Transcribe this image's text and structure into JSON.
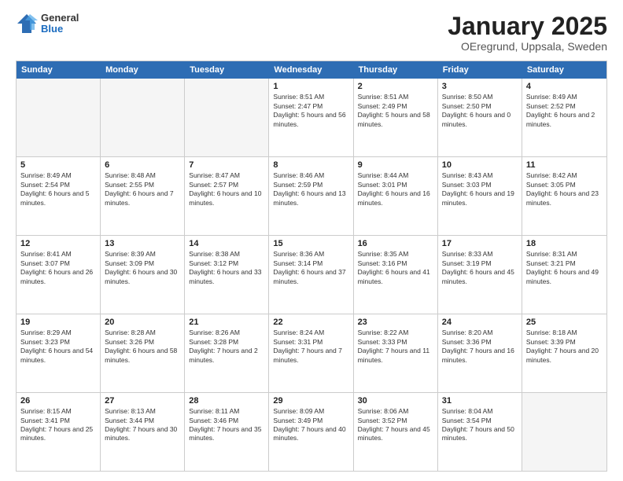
{
  "logo": {
    "general": "General",
    "blue": "Blue"
  },
  "title": "January 2025",
  "location": "OEregrund, Uppsala, Sweden",
  "header_days": [
    "Sunday",
    "Monday",
    "Tuesday",
    "Wednesday",
    "Thursday",
    "Friday",
    "Saturday"
  ],
  "weeks": [
    [
      {
        "day": "",
        "sunrise": "",
        "sunset": "",
        "daylight": ""
      },
      {
        "day": "",
        "sunrise": "",
        "sunset": "",
        "daylight": ""
      },
      {
        "day": "",
        "sunrise": "",
        "sunset": "",
        "daylight": ""
      },
      {
        "day": "1",
        "sunrise": "Sunrise: 8:51 AM",
        "sunset": "Sunset: 2:47 PM",
        "daylight": "Daylight: 5 hours and 56 minutes."
      },
      {
        "day": "2",
        "sunrise": "Sunrise: 8:51 AM",
        "sunset": "Sunset: 2:49 PM",
        "daylight": "Daylight: 5 hours and 58 minutes."
      },
      {
        "day": "3",
        "sunrise": "Sunrise: 8:50 AM",
        "sunset": "Sunset: 2:50 PM",
        "daylight": "Daylight: 6 hours and 0 minutes."
      },
      {
        "day": "4",
        "sunrise": "Sunrise: 8:49 AM",
        "sunset": "Sunset: 2:52 PM",
        "daylight": "Daylight: 6 hours and 2 minutes."
      }
    ],
    [
      {
        "day": "5",
        "sunrise": "Sunrise: 8:49 AM",
        "sunset": "Sunset: 2:54 PM",
        "daylight": "Daylight: 6 hours and 5 minutes."
      },
      {
        "day": "6",
        "sunrise": "Sunrise: 8:48 AM",
        "sunset": "Sunset: 2:55 PM",
        "daylight": "Daylight: 6 hours and 7 minutes."
      },
      {
        "day": "7",
        "sunrise": "Sunrise: 8:47 AM",
        "sunset": "Sunset: 2:57 PM",
        "daylight": "Daylight: 6 hours and 10 minutes."
      },
      {
        "day": "8",
        "sunrise": "Sunrise: 8:46 AM",
        "sunset": "Sunset: 2:59 PM",
        "daylight": "Daylight: 6 hours and 13 minutes."
      },
      {
        "day": "9",
        "sunrise": "Sunrise: 8:44 AM",
        "sunset": "Sunset: 3:01 PM",
        "daylight": "Daylight: 6 hours and 16 minutes."
      },
      {
        "day": "10",
        "sunrise": "Sunrise: 8:43 AM",
        "sunset": "Sunset: 3:03 PM",
        "daylight": "Daylight: 6 hours and 19 minutes."
      },
      {
        "day": "11",
        "sunrise": "Sunrise: 8:42 AM",
        "sunset": "Sunset: 3:05 PM",
        "daylight": "Daylight: 6 hours and 23 minutes."
      }
    ],
    [
      {
        "day": "12",
        "sunrise": "Sunrise: 8:41 AM",
        "sunset": "Sunset: 3:07 PM",
        "daylight": "Daylight: 6 hours and 26 minutes."
      },
      {
        "day": "13",
        "sunrise": "Sunrise: 8:39 AM",
        "sunset": "Sunset: 3:09 PM",
        "daylight": "Daylight: 6 hours and 30 minutes."
      },
      {
        "day": "14",
        "sunrise": "Sunrise: 8:38 AM",
        "sunset": "Sunset: 3:12 PM",
        "daylight": "Daylight: 6 hours and 33 minutes."
      },
      {
        "day": "15",
        "sunrise": "Sunrise: 8:36 AM",
        "sunset": "Sunset: 3:14 PM",
        "daylight": "Daylight: 6 hours and 37 minutes."
      },
      {
        "day": "16",
        "sunrise": "Sunrise: 8:35 AM",
        "sunset": "Sunset: 3:16 PM",
        "daylight": "Daylight: 6 hours and 41 minutes."
      },
      {
        "day": "17",
        "sunrise": "Sunrise: 8:33 AM",
        "sunset": "Sunset: 3:19 PM",
        "daylight": "Daylight: 6 hours and 45 minutes."
      },
      {
        "day": "18",
        "sunrise": "Sunrise: 8:31 AM",
        "sunset": "Sunset: 3:21 PM",
        "daylight": "Daylight: 6 hours and 49 minutes."
      }
    ],
    [
      {
        "day": "19",
        "sunrise": "Sunrise: 8:29 AM",
        "sunset": "Sunset: 3:23 PM",
        "daylight": "Daylight: 6 hours and 54 minutes."
      },
      {
        "day": "20",
        "sunrise": "Sunrise: 8:28 AM",
        "sunset": "Sunset: 3:26 PM",
        "daylight": "Daylight: 6 hours and 58 minutes."
      },
      {
        "day": "21",
        "sunrise": "Sunrise: 8:26 AM",
        "sunset": "Sunset: 3:28 PM",
        "daylight": "Daylight: 7 hours and 2 minutes."
      },
      {
        "day": "22",
        "sunrise": "Sunrise: 8:24 AM",
        "sunset": "Sunset: 3:31 PM",
        "daylight": "Daylight: 7 hours and 7 minutes."
      },
      {
        "day": "23",
        "sunrise": "Sunrise: 8:22 AM",
        "sunset": "Sunset: 3:33 PM",
        "daylight": "Daylight: 7 hours and 11 minutes."
      },
      {
        "day": "24",
        "sunrise": "Sunrise: 8:20 AM",
        "sunset": "Sunset: 3:36 PM",
        "daylight": "Daylight: 7 hours and 16 minutes."
      },
      {
        "day": "25",
        "sunrise": "Sunrise: 8:18 AM",
        "sunset": "Sunset: 3:39 PM",
        "daylight": "Daylight: 7 hours and 20 minutes."
      }
    ],
    [
      {
        "day": "26",
        "sunrise": "Sunrise: 8:15 AM",
        "sunset": "Sunset: 3:41 PM",
        "daylight": "Daylight: 7 hours and 25 minutes."
      },
      {
        "day": "27",
        "sunrise": "Sunrise: 8:13 AM",
        "sunset": "Sunset: 3:44 PM",
        "daylight": "Daylight: 7 hours and 30 minutes."
      },
      {
        "day": "28",
        "sunrise": "Sunrise: 8:11 AM",
        "sunset": "Sunset: 3:46 PM",
        "daylight": "Daylight: 7 hours and 35 minutes."
      },
      {
        "day": "29",
        "sunrise": "Sunrise: 8:09 AM",
        "sunset": "Sunset: 3:49 PM",
        "daylight": "Daylight: 7 hours and 40 minutes."
      },
      {
        "day": "30",
        "sunrise": "Sunrise: 8:06 AM",
        "sunset": "Sunset: 3:52 PM",
        "daylight": "Daylight: 7 hours and 45 minutes."
      },
      {
        "day": "31",
        "sunrise": "Sunrise: 8:04 AM",
        "sunset": "Sunset: 3:54 PM",
        "daylight": "Daylight: 7 hours and 50 minutes."
      },
      {
        "day": "",
        "sunrise": "",
        "sunset": "",
        "daylight": ""
      }
    ]
  ]
}
